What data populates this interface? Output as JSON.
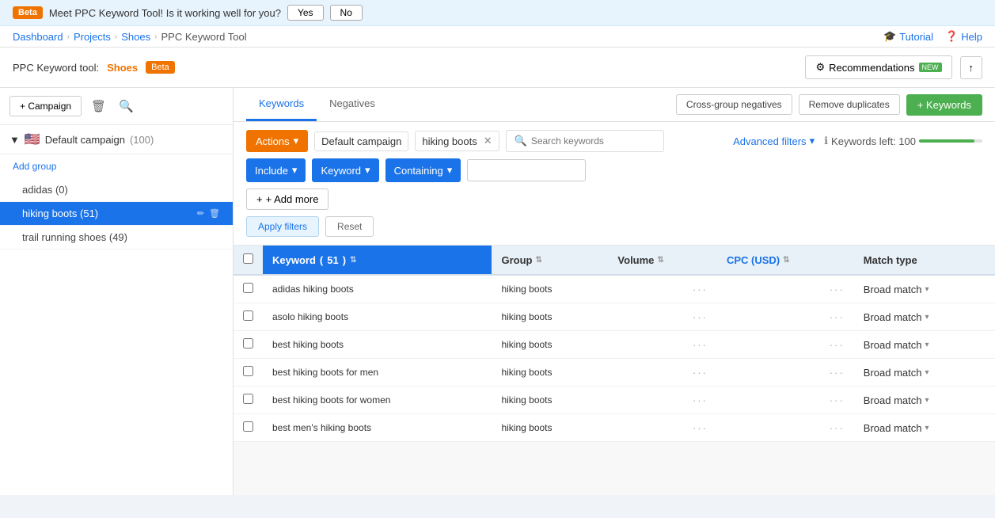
{
  "banner": {
    "beta_label": "Beta",
    "message": "Meet PPC Keyword Tool!  Is it working well for you?",
    "yes_label": "Yes",
    "no_label": "No"
  },
  "breadcrumb": {
    "dashboard": "Dashboard",
    "projects": "Projects",
    "shoes": "Shoes",
    "tool": "PPC Keyword Tool"
  },
  "header": {
    "title_prefix": "PPC Keyword tool:",
    "title_highlight": "Shoes",
    "beta": "Beta",
    "tutorial_label": "Tutorial",
    "help_label": "Help",
    "recommendations_label": "Recommendations",
    "new_badge": "NEW",
    "export_label": "↑"
  },
  "sidebar": {
    "add_campaign_label": "+ Campaign",
    "campaign_name": "Default campaign",
    "campaign_count": "(100)",
    "add_group_label": "Add group",
    "items": [
      {
        "label": "adidas",
        "count": "(0)",
        "active": false
      },
      {
        "label": "hiking boots",
        "count": "(51)",
        "active": true
      },
      {
        "label": "trail running shoes",
        "count": "(49)",
        "active": false
      }
    ]
  },
  "tabs": {
    "keywords_label": "Keywords",
    "negatives_label": "Negatives",
    "cross_group_negatives": "Cross-group negatives",
    "remove_duplicates": "Remove duplicates",
    "add_keywords": "+ Keywords"
  },
  "filters": {
    "actions_label": "Actions",
    "tag_label": "Default campaign",
    "tag2_label": "hiking boots",
    "search_placeholder": "Search keywords",
    "advanced_filters": "Advanced filters",
    "keywords_left": "Keywords left: 100",
    "include_label": "Include",
    "keyword_label": "Keyword",
    "containing_label": "Containing",
    "add_more_label": "+ Add more",
    "apply_label": "Apply filters",
    "reset_label": "Reset"
  },
  "table": {
    "col_keyword": "Keyword",
    "col_keyword_count": "51",
    "col_group": "Group",
    "col_volume": "Volume",
    "col_cpc": "CPC (USD)",
    "col_match": "Match type",
    "rows": [
      {
        "keyword": "adidas hiking boots",
        "group": "hiking boots",
        "volume": "···",
        "cpc": "···",
        "match": "Broad match"
      },
      {
        "keyword": "asolo hiking boots",
        "group": "hiking boots",
        "volume": "···",
        "cpc": "···",
        "match": "Broad match"
      },
      {
        "keyword": "best hiking boots",
        "group": "hiking boots",
        "volume": "···",
        "cpc": "···",
        "match": "Broad match"
      },
      {
        "keyword": "best hiking boots for men",
        "group": "hiking boots",
        "volume": "···",
        "cpc": "···",
        "match": "Broad match"
      },
      {
        "keyword": "best hiking boots for women",
        "group": "hiking boots",
        "volume": "···",
        "cpc": "···",
        "match": "Broad match"
      },
      {
        "keyword": "best men's hiking boots",
        "group": "hiking boots",
        "volume": "···",
        "cpc": "···",
        "match": "Broad match"
      }
    ]
  },
  "colors": {
    "orange": "#f07300",
    "blue": "#1a73e8",
    "green": "#4caf50"
  }
}
